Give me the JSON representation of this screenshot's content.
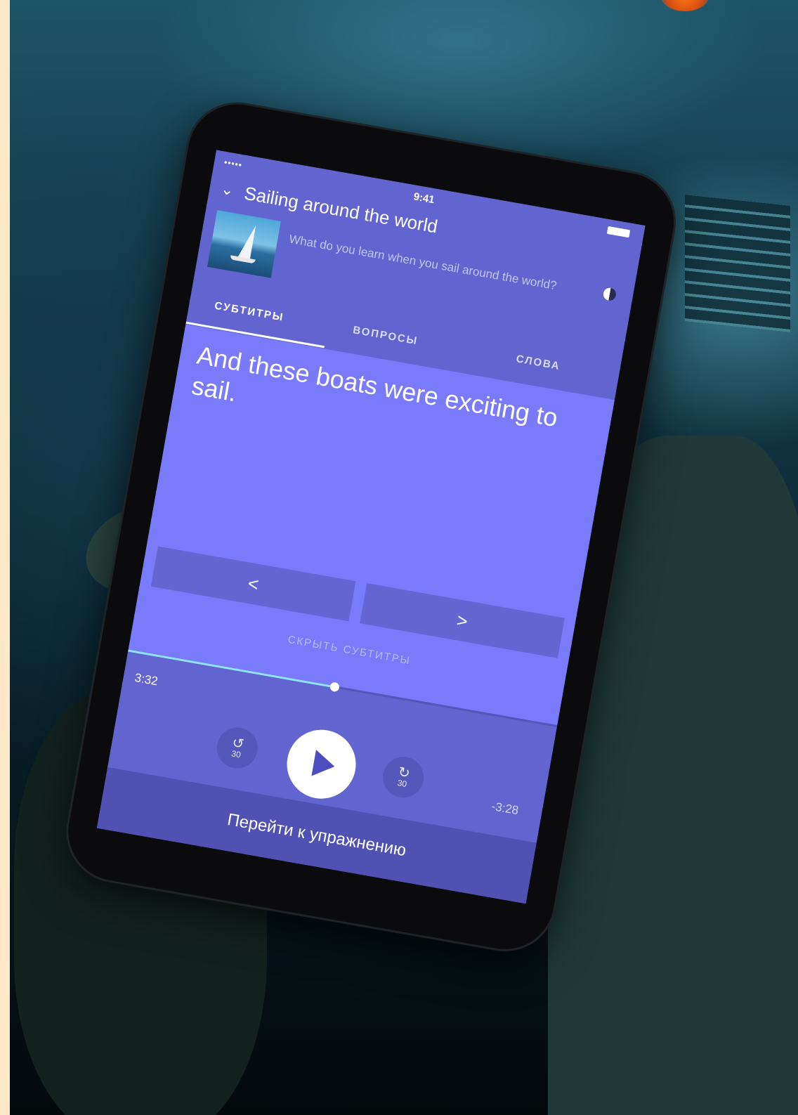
{
  "status_bar": {
    "signal": "•••••",
    "time": "9:41"
  },
  "header": {
    "title": "Sailing around the world",
    "subtitle": "What do you learn when you sail around the world?"
  },
  "tabs": [
    {
      "label": "СУБТИТРЫ",
      "active": true
    },
    {
      "label": "ВОПРОСЫ",
      "active": false
    },
    {
      "label": "СЛОВА",
      "active": false
    }
  ],
  "subtitle_text": "And these boats were exciting to sail.",
  "nav": {
    "prev_label": "<",
    "next_label": ">"
  },
  "hide_subtitles_label": "СКРЫТЬ СУБТИТРЫ",
  "player": {
    "elapsed": "3:32",
    "remaining": "-3:28",
    "progress": 0.48,
    "rewind_seconds": "30",
    "forward_seconds": "30"
  },
  "footer_button_label": "Перейти к упражнению",
  "colors": {
    "screen_bg": "#6265cf",
    "content_bg": "#7a7bfb",
    "footer_bg": "#5151b3",
    "progress_fill": "#8fe3ff"
  }
}
